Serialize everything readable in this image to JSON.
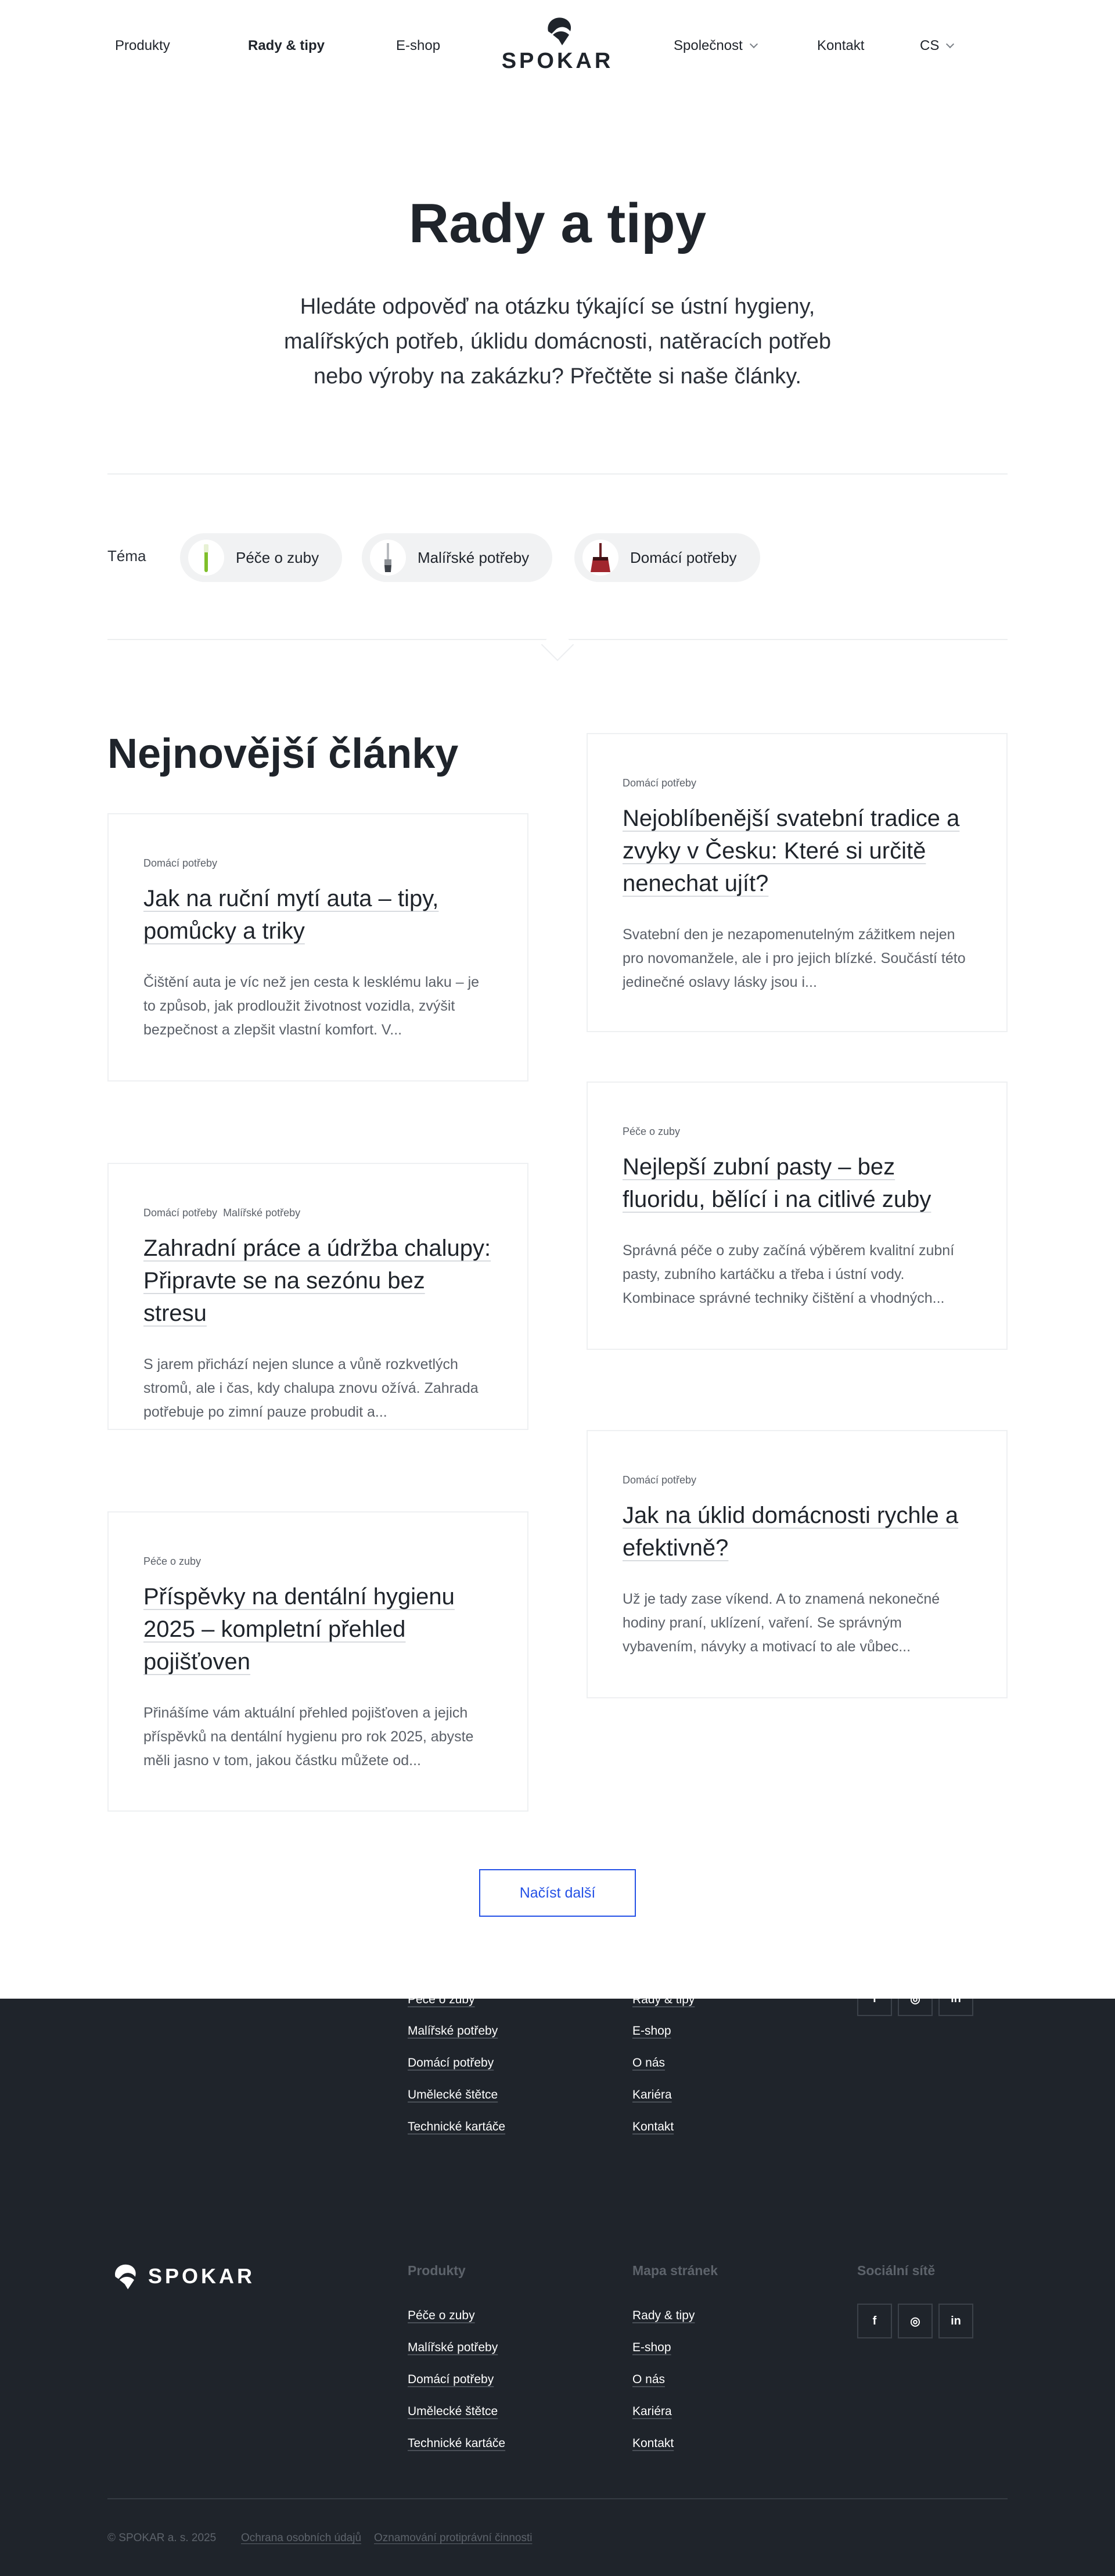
{
  "nav": {
    "left": [
      "Produkty",
      "Rady & tipy",
      "E-shop"
    ],
    "right_company": "Společnost",
    "right_contact": "Kontakt",
    "lang": "CS"
  },
  "brand": {
    "name": "SPOKAR"
  },
  "hero": {
    "title": "Rady a tipy",
    "intro_line1": "Hledáte odpověď na otázku týkající se ústní hygieny,",
    "intro_line2": "malířských potřeb, úklidu domácnosti, natěracích potřeb",
    "intro_line3": "nebo výroby na zakázku? Přečtěte si naše články."
  },
  "topics": {
    "label": "Téma",
    "items": [
      "Péče o zuby",
      "Malířské potřeby",
      "Domácí potřeby"
    ]
  },
  "articles": {
    "title": "Nejnovější články",
    "items": [
      {
        "tags": [
          "Domácí potřeby"
        ],
        "title": "Nejoblíbenější svatební tradice a zvyky v Česku: Které si určitě nenechat ujít?",
        "text": "Svatební den je nezapomenutelným zážitkem nejen pro novomanžele, ale i pro jejich blízké. Součástí této jedinečné oslavy lásky jsou i..."
      },
      {
        "tags": [
          "Domácí potřeby"
        ],
        "title": "Jak na ruční mytí auta – tipy, pomůcky a triky",
        "text": "Čištění auta je víc než jen cesta k lesklému laku – je to způsob, jak prodloužit životnost vozidla, zvýšit bezpečnost a zlepšit vlastní komfort. V..."
      },
      {
        "tags": [
          "Péče o zuby"
        ],
        "title": "Nejlepší zubní pasty – bez fluoridu, bělící i na citlivé zuby",
        "text": "Správná péče o zuby začíná výběrem kvalitní zubní pasty, zubního kartáčku a třeba i ústní vody. Kombinace správné techniky čištění a vhodných..."
      },
      {
        "tags": [
          "Domácí potřeby",
          "Malířské potřeby"
        ],
        "title": "Zahradní práce a údržba chalupy: Připravte se na sezónu bez stresu",
        "text": "S jarem přichází nejen slunce a vůně rozkvetlých stromů, ale i čas, kdy chalupa znovu ožívá. Zahrada potřebuje po zimní pauze probudit a..."
      },
      {
        "tags": [
          "Domácí potřeby"
        ],
        "title": "Jak na úklid domácnosti rychle a efektivně?",
        "text": "Už je tady zase víkend. A to znamená nekonečné hodiny praní, uklízení, vaření. Se správným vybavením, návyky a motivací to ale vůbec..."
      },
      {
        "tags": [
          "Péče o zuby"
        ],
        "title": "Příspěvky na dentální hygienu 2025 – kompletní přehled pojišťoven",
        "text": "Přinášíme vám aktuální přehled pojišťoven a jejich příspěvků na dentální hygienu pro rok 2025, abyste měli jasno v tom, jakou částku můžete od..."
      }
    ],
    "load_more": "Načíst další"
  },
  "footer": {
    "col_products_title": "Produkty",
    "col_sitemap_title": "Mapa stránek",
    "col_social_title": "Sociální sítě",
    "products": [
      "Péče o zuby",
      "Malířské potřeby",
      "Domácí potřeby",
      "Umělecké štětce",
      "Technické kartáče"
    ],
    "sitemap": [
      "Rady & tipy",
      "E-shop",
      "O nás",
      "Kariéra",
      "Kontakt"
    ],
    "social": [
      "f",
      "◎",
      "in"
    ],
    "copyright": "© SPOKAR a. s. 2025",
    "privacy": "Ochrana osobních údajů",
    "whistleblowing": "Oznamování protiprávní činnosti"
  },
  "colors": {
    "text": "#1f242b",
    "accent": "#2451e6",
    "footer_bg": "#1f242b"
  }
}
